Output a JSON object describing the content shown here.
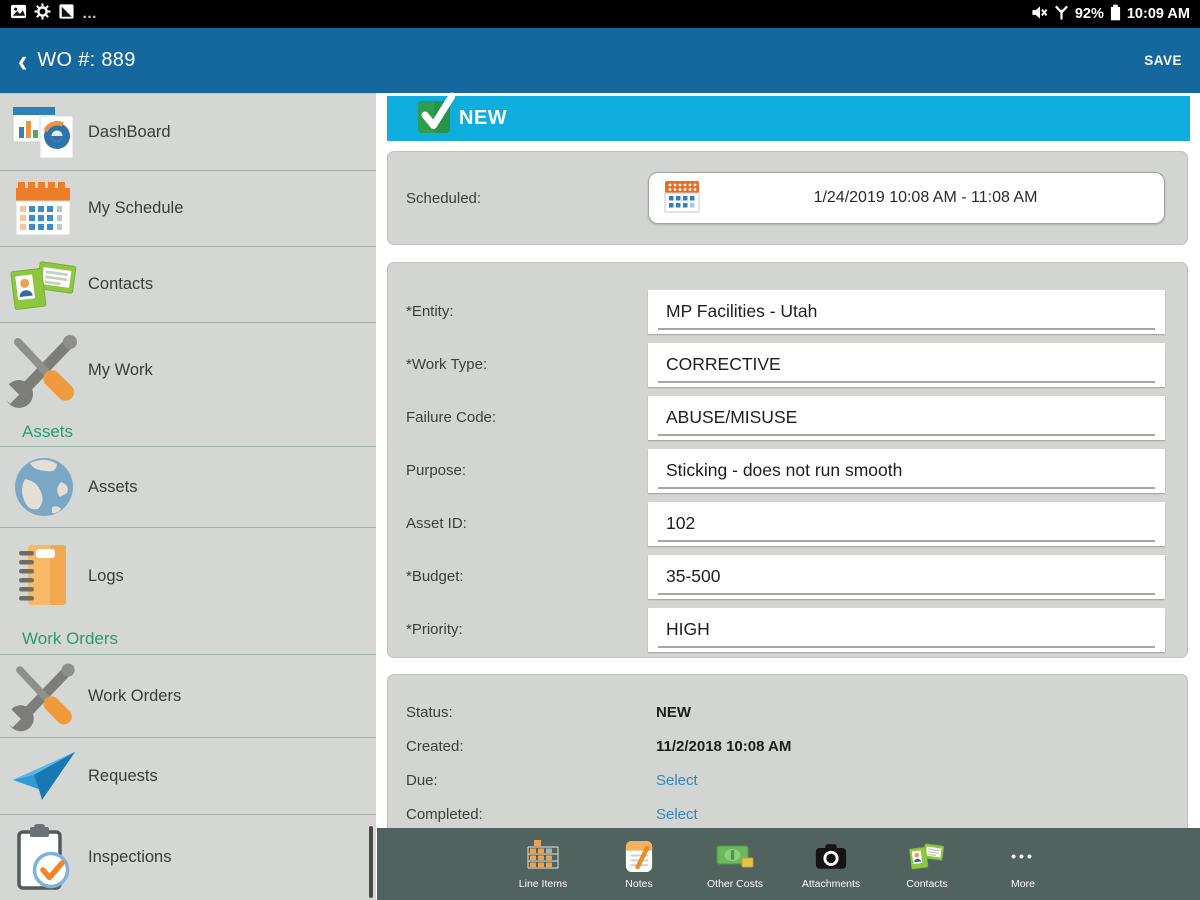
{
  "status_bar": {
    "overflow_glyph": "…",
    "battery_pct": "92%",
    "time": "10:09 AM"
  },
  "header": {
    "back_glyph": "‹",
    "title": "WO #: 889",
    "save_label": "SAVE"
  },
  "sidebar": {
    "items": [
      {
        "type": "nav",
        "icon": "dashboard-icon",
        "label": "DashBoard"
      },
      {
        "type": "nav",
        "icon": "schedule-calendar-icon",
        "label": "My Schedule"
      },
      {
        "type": "nav",
        "icon": "contacts-cards-icon",
        "label": "Contacts"
      },
      {
        "type": "nav",
        "icon": "wrench-screwdriver-icon",
        "label": "My Work"
      },
      {
        "type": "section",
        "label": "Assets"
      },
      {
        "type": "nav",
        "icon": "globe-icon",
        "label": "Assets"
      },
      {
        "type": "nav",
        "icon": "logs-notebook-icon",
        "label": "Logs"
      },
      {
        "type": "section",
        "label": "Work Orders"
      },
      {
        "type": "nav",
        "icon": "wrench-screwdriver-icon",
        "label": "Work Orders"
      },
      {
        "type": "nav",
        "icon": "paper-plane-icon",
        "label": "Requests"
      },
      {
        "type": "nav",
        "icon": "inspection-clipboard-icon",
        "label": "Inspections"
      }
    ]
  },
  "banner": {
    "status": "NEW"
  },
  "scheduled": {
    "label": "Scheduled:",
    "value": "1/24/2019 10:08 AM - 11:08 AM"
  },
  "form": {
    "fields": [
      {
        "label": "*Entity:",
        "value": "MP Facilities - Utah"
      },
      {
        "label": "*Work Type:",
        "value": "CORRECTIVE"
      },
      {
        "label": "Failure Code:",
        "value": "ABUSE/MISUSE"
      },
      {
        "label": "Purpose:",
        "value": "Sticking - does not run smooth"
      },
      {
        "label": "Asset ID:",
        "value": "102"
      },
      {
        "label": "*Budget:",
        "value": "35-500"
      },
      {
        "label": "*Priority:",
        "value": "HIGH"
      }
    ]
  },
  "status_panel": {
    "rows": [
      {
        "label": "Status:",
        "value": "NEW",
        "kind": "bold"
      },
      {
        "label": "Created:",
        "value": "11/2/2018 10:08 AM",
        "kind": "bold"
      },
      {
        "label": "Due:",
        "value": "Select",
        "kind": "link"
      },
      {
        "label": "Completed:",
        "value": "Select",
        "kind": "link"
      }
    ]
  },
  "toolbar": {
    "items": [
      {
        "label": "Line Items",
        "icon": "line-items-icon"
      },
      {
        "label": "Notes",
        "icon": "notes-icon"
      },
      {
        "label": "Other Costs",
        "icon": "other-costs-icon"
      },
      {
        "label": "Attachments",
        "icon": "camera-icon"
      },
      {
        "label": "Contacts",
        "icon": "contacts-small-icon"
      },
      {
        "label": "More",
        "icon": "more-dots-icon",
        "glyph": "•••"
      }
    ]
  },
  "colors": {
    "header_blue": "#15689e",
    "banner_cyan": "#0fadde",
    "check_green": "#2d9e50",
    "section_teal": "#279b78",
    "toolbar_bg": "#50635f",
    "link_blue": "#2f86c2"
  }
}
